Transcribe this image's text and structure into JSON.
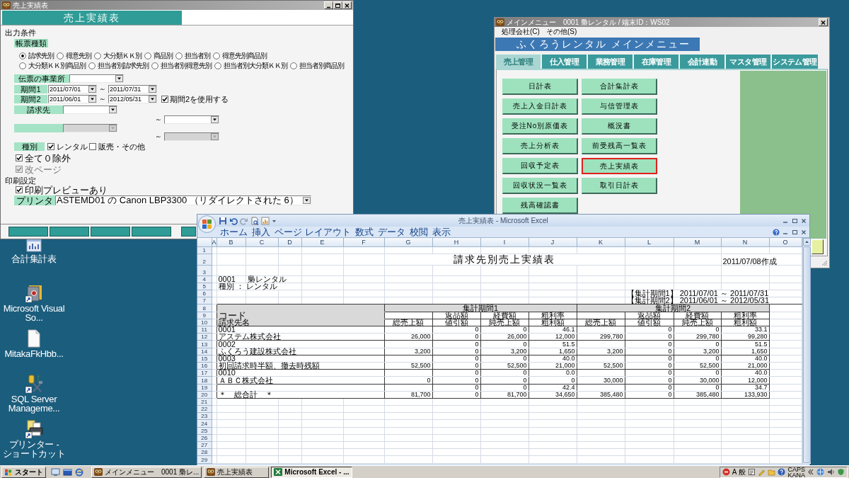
{
  "desktop_icons": [
    {
      "kind": "chart",
      "label": "合計集計表",
      "shortcut": false
    },
    {
      "kind": "safe",
      "label": "Microsoft Visual So...",
      "shortcut": true
    },
    {
      "kind": "document",
      "label": "MitakaFkHbb...",
      "shortcut": false
    },
    {
      "kind": "tools",
      "label": "SQL Server Manageme...",
      "shortcut": true
    },
    {
      "kind": "printer",
      "label": "プリンター - ショートカット",
      "shortcut": true
    }
  ],
  "report_window": {
    "title": "売上実績表",
    "heading": "売上実績表",
    "section": "出力条件",
    "report_type": {
      "label": "帳票種類",
      "options": [
        {
          "label": "請求先別",
          "selected": true
        },
        {
          "label": "得意先別",
          "selected": false
        },
        {
          "label": "大分類ＫＫ別",
          "selected": false
        },
        {
          "label": "商品別",
          "selected": false
        },
        {
          "label": "担当者別",
          "selected": false
        },
        {
          "label": "得意先別商品別",
          "selected": false
        },
        {
          "label": "大分類ＫＫ別商品別",
          "selected": false
        },
        {
          "label": "担当者別請求先別",
          "selected": false
        },
        {
          "label": "担当者別得意先別",
          "selected": false
        },
        {
          "label": "担当者別大分類ＫＫ別",
          "selected": false
        },
        {
          "label": "担当者別商品別",
          "selected": false
        }
      ]
    },
    "office": {
      "label": "伝票の事業所"
    },
    "periods": [
      {
        "label": "期間1",
        "from": "2011/07/01",
        "separator": "～",
        "to": "2011/07/31"
      },
      {
        "label": "期間2",
        "from": "2011/06/01",
        "separator": "～",
        "to": "2012/05/31",
        "option": {
          "label": "期間2を使用する",
          "checked": true
        }
      }
    ],
    "ranges": [
      {
        "label": "請求先",
        "separator": "～",
        "disabled": false
      },
      {
        "separator": "～",
        "disabled": true
      }
    ],
    "category": {
      "label": "種別",
      "options": [
        {
          "label": "レンタル",
          "checked": true
        },
        {
          "label": "販売・その他",
          "checked": false
        }
      ]
    },
    "flags": [
      {
        "label": "全て０除外",
        "checked": true,
        "disabled": false
      },
      {
        "label": "改ページ",
        "checked": true,
        "disabled": true
      }
    ],
    "print_section": "印刷設定",
    "print_preview": {
      "label": "印刷プレビューあり",
      "checked": true
    },
    "printer": {
      "label": "プリンタ",
      "value": "ASTEMD01 の Canon LBP3300 （リダイレクトされた 6）"
    }
  },
  "menu_window": {
    "title": "メインメニュー　0001 梟レンタル / 端末ID：WS02",
    "menus": [
      "処理会社(C)",
      "その他(S)"
    ],
    "heading": "ふくろうレンタル メインメニュー",
    "tabs": [
      {
        "label": "売上管理",
        "selected": true
      },
      {
        "label": "仕入管理",
        "selected": false
      },
      {
        "label": "業務管理",
        "selected": false
      },
      {
        "label": "在庫管理",
        "selected": false
      },
      {
        "label": "会計連動",
        "selected": false
      },
      {
        "label": "マスタ管理",
        "selected": false
      },
      {
        "label": "システム管理",
        "selected": false
      }
    ],
    "buttons": [
      {
        "label": "日計表",
        "selected": false
      },
      {
        "label": "合計集計表",
        "selected": false
      },
      {
        "label": "売上入金日計表",
        "selected": false
      },
      {
        "label": "与信管理表",
        "selected": false
      },
      {
        "label": "受注No別原価表",
        "selected": false
      },
      {
        "label": "概況書",
        "selected": false
      },
      {
        "label": "売上分析表",
        "selected": false
      },
      {
        "label": "前受残高一覧表",
        "selected": false
      },
      {
        "label": "回収予定表",
        "selected": false
      },
      {
        "label": "売上実績表",
        "selected": true
      },
      {
        "label": "回収状況一覧表",
        "selected": false
      },
      {
        "label": "取引日計表",
        "selected": false
      },
      {
        "label": "残高確認書",
        "selected": false
      }
    ]
  },
  "excel_window": {
    "title": "売上実績表 - Microsoft Excel",
    "ribbon_tabs": [
      "ホーム",
      "挿入",
      "ページ レイアウト",
      "数式",
      "データ",
      "校閲",
      "表示"
    ],
    "columns": [
      "A",
      "B",
      "C",
      "D",
      "E",
      "F",
      "G",
      "H",
      "I",
      "J",
      "K",
      "L",
      "M",
      "N",
      "O"
    ],
    "row_numbers": [
      "1",
      "2",
      "3",
      "4",
      "5",
      "6",
      "7",
      "8",
      "9",
      "10",
      "11",
      "12",
      "13",
      "14",
      "15",
      "16",
      "17",
      "18",
      "19",
      "20",
      "21",
      "22",
      "23",
      "24",
      "25",
      "26",
      "27",
      "28",
      "29"
    ],
    "sheet": {
      "title": "請求先別売上実績表",
      "created": "2011/07/08作成",
      "company_code": "0001",
      "company_name": "梟レンタル",
      "category": "種別 ： レンタル",
      "period_notes": [
        "【集計期間1】 2011/07/01 ～ 2011/07/31",
        "【集計期間2】 2011/06/01 ～ 2012/05/31"
      ],
      "code_header": "コード",
      "name_header": "請求先名",
      "groups": [
        {
          "label": "集計期間1",
          "upper": [
            "返品額",
            "経費額",
            "粗利率"
          ],
          "lower": [
            "総売上額",
            "値引額",
            "純売上額",
            "粗利額"
          ]
        },
        {
          "label": "集計期間2",
          "upper": [
            "返品額",
            "経費額",
            "粗利率"
          ],
          "lower": [
            "総売上額",
            "値引額",
            "純売上額",
            "粗利額"
          ]
        }
      ],
      "records": [
        {
          "code": "0001",
          "name": "アステム株式会社",
          "periods": [
            {
              "upper": [
                "0",
                "0",
                "46.1"
              ],
              "lower": [
                "26,000",
                "0",
                "26,000",
                "12,000"
              ]
            },
            {
              "upper": [
                "0",
                "0",
                "33.1"
              ],
              "lower": [
                "299,780",
                "0",
                "299,780",
                "99,280"
              ]
            }
          ]
        },
        {
          "code": "0002",
          "name": "ふくろう建設株式会社",
          "periods": [
            {
              "upper": [
                "0",
                "0",
                "51.5"
              ],
              "lower": [
                "3,200",
                "0",
                "3,200",
                "1,650"
              ]
            },
            {
              "upper": [
                "0",
                "0",
                "51.5"
              ],
              "lower": [
                "3,200",
                "0",
                "3,200",
                "1,650"
              ]
            }
          ]
        },
        {
          "code": "0003",
          "name": "初回請求時半額、撤去時残額",
          "periods": [
            {
              "upper": [
                "0",
                "0",
                "40.0"
              ],
              "lower": [
                "52,500",
                "0",
                "52,500",
                "21,000"
              ]
            },
            {
              "upper": [
                "0",
                "0",
                "40.0"
              ],
              "lower": [
                "52,500",
                "0",
                "52,500",
                "21,000"
              ]
            }
          ]
        },
        {
          "code": "0010",
          "name": "ＡＢＣ株式会社",
          "periods": [
            {
              "upper": [
                "0",
                "0",
                "0.0"
              ],
              "lower": [
                "0",
                "0",
                "0",
                "0"
              ]
            },
            {
              "upper": [
                "0",
                "0",
                "40.0"
              ],
              "lower": [
                "30,000",
                "0",
                "30,000",
                "12,000"
              ]
            }
          ]
        },
        {
          "name": "＊　総合計　＊",
          "periods": [
            {
              "upper": [
                "0",
                "0",
                "42.4"
              ],
              "lower": [
                "81,700",
                "0",
                "81,700",
                "34,650"
              ]
            },
            {
              "upper": [
                "0",
                "0",
                "34.7"
              ],
              "lower": [
                "385,480",
                "0",
                "385,480",
                "133,930"
              ]
            }
          ]
        }
      ]
    }
  },
  "taskbar": {
    "start": "スタート",
    "tasks": [
      {
        "kind": "app",
        "label": "メインメニュー　0001 梟レ...",
        "selected": false
      },
      {
        "kind": "app",
        "label": "売上実績表",
        "selected": false
      },
      {
        "kind": "excel",
        "label": "Microsoft Excel - ...",
        "selected": true
      }
    ],
    "ime": [
      "A",
      "般"
    ],
    "locks": [
      "CAPS",
      "KANA"
    ]
  }
}
